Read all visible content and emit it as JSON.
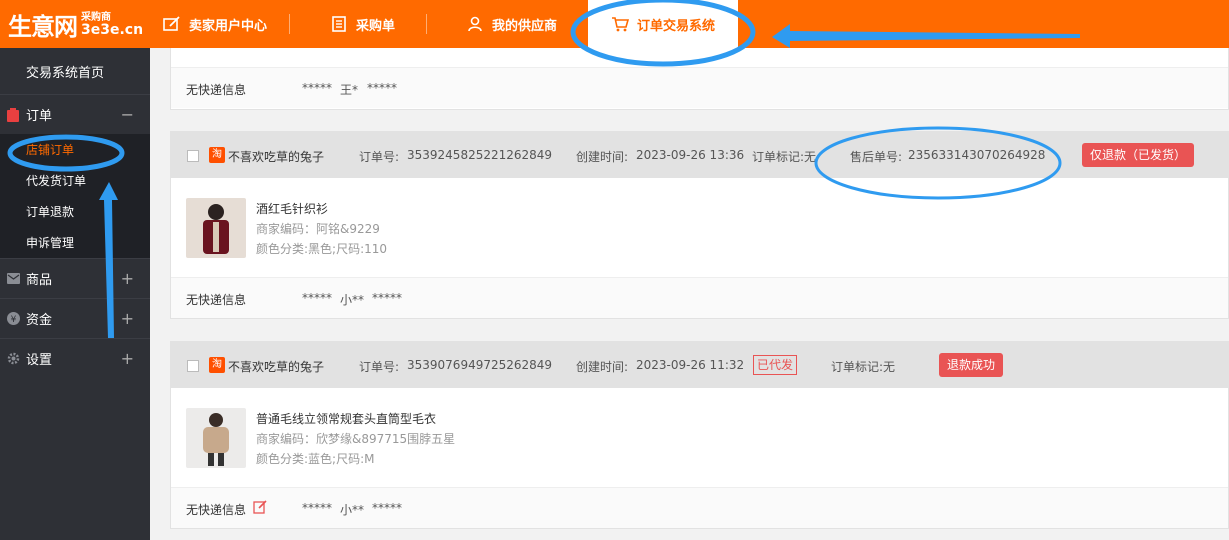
{
  "logo": {
    "main": "生意网",
    "sub_top": "采购商",
    "sub_bottom": "3e3e.cn"
  },
  "nav": [
    {
      "label": "卖家用户中心",
      "icon": "edit-icon"
    },
    {
      "label": "采购单",
      "icon": "list-icon"
    },
    {
      "label": "我的供应商",
      "icon": "user-icon"
    },
    {
      "label": "订单交易系统",
      "icon": "cart-icon"
    }
  ],
  "sidebar": {
    "home": "交易系统首页",
    "order_group": {
      "label": "订单",
      "toggle": "−"
    },
    "order_items": [
      "店铺订单",
      "代发货订单",
      "订单退款",
      "申诉管理"
    ],
    "groups": [
      {
        "label": "商品",
        "toggle": "+"
      },
      {
        "label": "资金",
        "toggle": "+"
      },
      {
        "label": "设置",
        "toggle": "+"
      }
    ]
  },
  "orders": [
    {
      "footer": {
        "no_express": "无快递信息",
        "masked_a": "*****",
        "name": "王*",
        "masked_b": "*****"
      }
    },
    {
      "shop": "不喜欢吃草的兔子",
      "shop_badge": "淘",
      "order_no_label": "订单号:",
      "order_no": "3539245825221262849",
      "created_label": "创建时间:",
      "created": "2023-09-26 13:36",
      "mark": "订单标记:无",
      "after_sale_label": "售后单号:",
      "after_sale_no": "235633143070264928",
      "status_button": "仅退款（已发货）",
      "product": {
        "name": "酒红毛针织衫",
        "code": "商家编码：阿铭&9229",
        "sku": "颜色分类:黑色;尺码:110"
      },
      "footer": {
        "no_express": "无快递信息",
        "masked_a": "*****",
        "name": "小**",
        "masked_b": "*****"
      }
    },
    {
      "shop": "不喜欢吃草的兔子",
      "shop_badge": "淘",
      "order_no_label": "订单号:",
      "order_no": "3539076949725262849",
      "created_label": "创建时间:",
      "created": "2023-09-26 11:32",
      "tag": "已代发",
      "mark": "订单标记:无",
      "status_button": "退款成功",
      "product": {
        "name": "普通毛线立领常规套头直筒型毛衣",
        "code": "商家编码：欣梦缘&897715围脖五星",
        "sku": "颜色分类:蓝色;尺码:M"
      },
      "footer": {
        "no_express": "无快递信息",
        "masked_a": "*****",
        "name": "小**",
        "masked_b": "*****"
      }
    }
  ],
  "colors": {
    "brand": "#ff6a00",
    "annotation": "#2f9bf0",
    "danger": "#e95454"
  }
}
